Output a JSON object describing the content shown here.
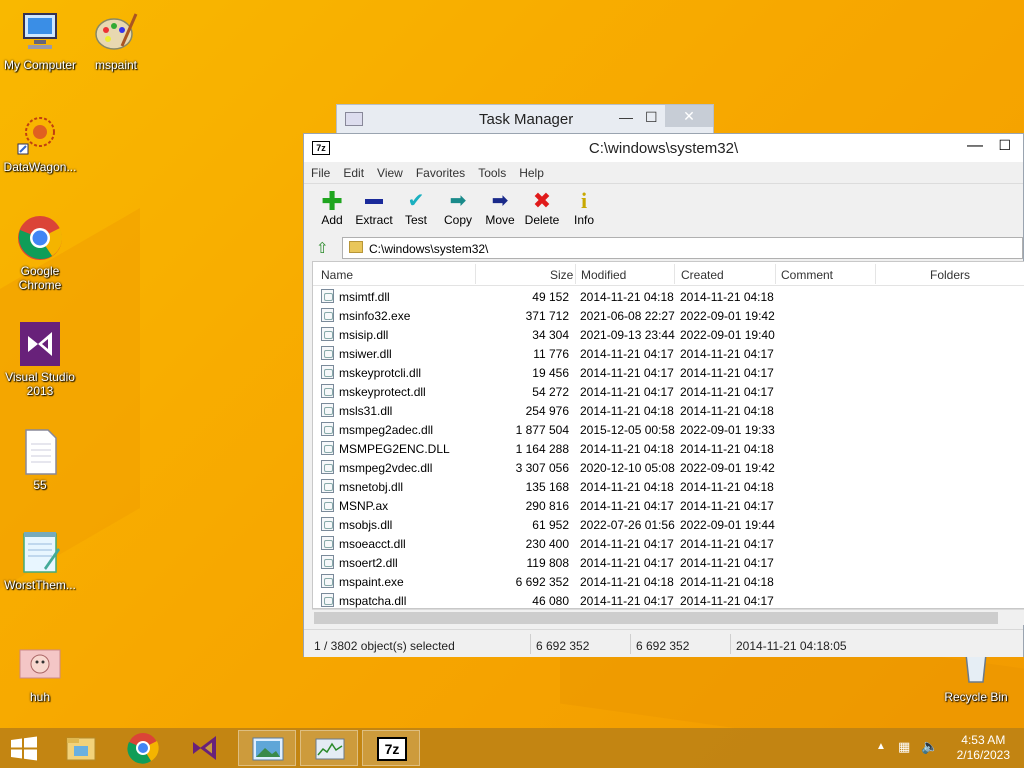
{
  "desktop": {
    "icons": [
      {
        "label": "My Computer"
      },
      {
        "label": "mspaint"
      },
      {
        "label": "DataWagon..."
      },
      {
        "label": "Google Chrome"
      },
      {
        "label": "Visual Studio 2013"
      },
      {
        "label": "55"
      },
      {
        "label": "WorstThem..."
      },
      {
        "label": "huh"
      },
      {
        "label": "Recycle Bin"
      }
    ]
  },
  "taskmanager": {
    "title": "Task Manager"
  },
  "window": {
    "title": "C:\\windows\\system32\\",
    "logo": "7z",
    "menu": [
      "File",
      "Edit",
      "View",
      "Favorites",
      "Tools",
      "Help"
    ],
    "toolbar": [
      "Add",
      "Extract",
      "Test",
      "Copy",
      "Move",
      "Delete",
      "Info"
    ],
    "address": "C:\\windows\\system32\\",
    "columns": [
      "Name",
      "Size",
      "Modified",
      "Created",
      "Comment",
      "Folders"
    ],
    "files": [
      {
        "name": "msimtf.dll",
        "size": "49 152",
        "modified": "2014-11-21 04:18",
        "created": "2014-11-21 04:18"
      },
      {
        "name": "msinfo32.exe",
        "size": "371 712",
        "modified": "2021-06-08 22:27",
        "created": "2022-09-01 19:42"
      },
      {
        "name": "msisip.dll",
        "size": "34 304",
        "modified": "2021-09-13 23:44",
        "created": "2022-09-01 19:40"
      },
      {
        "name": "msiwer.dll",
        "size": "11 776",
        "modified": "2014-11-21 04:17",
        "created": "2014-11-21 04:17"
      },
      {
        "name": "mskeyprotcli.dll",
        "size": "19 456",
        "modified": "2014-11-21 04:17",
        "created": "2014-11-21 04:17"
      },
      {
        "name": "mskeyprotect.dll",
        "size": "54 272",
        "modified": "2014-11-21 04:17",
        "created": "2014-11-21 04:17"
      },
      {
        "name": "msls31.dll",
        "size": "254 976",
        "modified": "2014-11-21 04:18",
        "created": "2014-11-21 04:18"
      },
      {
        "name": "msmpeg2adec.dll",
        "size": "1 877 504",
        "modified": "2015-12-05 00:58",
        "created": "2022-09-01 19:33"
      },
      {
        "name": "MSMPEG2ENC.DLL",
        "size": "1 164 288",
        "modified": "2014-11-21 04:18",
        "created": "2014-11-21 04:18"
      },
      {
        "name": "msmpeg2vdec.dll",
        "size": "3 307 056",
        "modified": "2020-12-10 05:08",
        "created": "2022-09-01 19:42"
      },
      {
        "name": "msnetobj.dll",
        "size": "135 168",
        "modified": "2014-11-21 04:18",
        "created": "2014-11-21 04:18"
      },
      {
        "name": "MSNP.ax",
        "size": "290 816",
        "modified": "2014-11-21 04:17",
        "created": "2014-11-21 04:17"
      },
      {
        "name": "msobjs.dll",
        "size": "61 952",
        "modified": "2022-07-26 01:56",
        "created": "2022-09-01 19:44"
      },
      {
        "name": "msoeacct.dll",
        "size": "230 400",
        "modified": "2014-11-21 04:17",
        "created": "2014-11-21 04:17"
      },
      {
        "name": "msoert2.dll",
        "size": "119 808",
        "modified": "2014-11-21 04:17",
        "created": "2014-11-21 04:17"
      },
      {
        "name": "mspaint.exe",
        "size": "6 692 352",
        "modified": "2014-11-21 04:18",
        "created": "2014-11-21 04:18"
      },
      {
        "name": "mspatcha.dll",
        "size": "46 080",
        "modified": "2014-11-21 04:17",
        "created": "2014-11-21 04:17"
      }
    ],
    "status": {
      "selected": "1 / 3802 object(s) selected",
      "size": "6 692 352",
      "packed": "6 692 352",
      "date": "2014-11-21 04:18:05"
    }
  },
  "taskbar": {
    "time": "4:53 AM",
    "date": "2/16/2023",
    "active_label": "7z"
  },
  "colors": {
    "accent": "#f7a800",
    "taskbar": "#be8214"
  }
}
